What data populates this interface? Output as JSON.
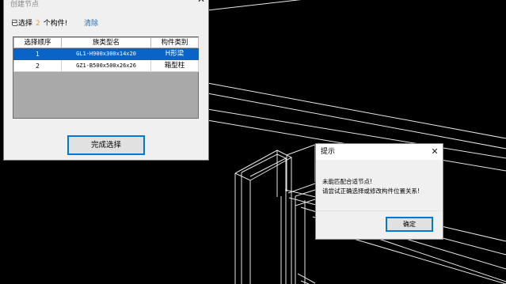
{
  "node_dialog": {
    "title": "创建节点",
    "close_glyph": "✕",
    "selection": {
      "prefix": "已选择",
      "count": "2",
      "suffix": "个构件!",
      "clear_label": "清除"
    },
    "table": {
      "headers": [
        "选择顺序",
        "族类型名",
        "构件类别"
      ],
      "rows": [
        [
          "1",
          "GL1-H900x300x14x20",
          "H形梁"
        ],
        [
          "2",
          "GZ1-B500x500x26x26",
          "箱型柱"
        ]
      ],
      "selected_row": 0
    },
    "finish_button": "完成选择"
  },
  "tip_dialog": {
    "title": "提示",
    "close_glyph": "✕",
    "message_line1": "未能匹配合适节点!",
    "message_line2": "请尝试正确选择或修改构件位置关系!",
    "ok_button": "确定"
  },
  "colors": {
    "canvas_bg": "#000000",
    "wireframe": "#e6e6e6",
    "selection_blue": "#0a64c8",
    "count_orange": "#e6a23c",
    "link_blue": "#1a6fd1",
    "button_focus": "#0078d7"
  }
}
